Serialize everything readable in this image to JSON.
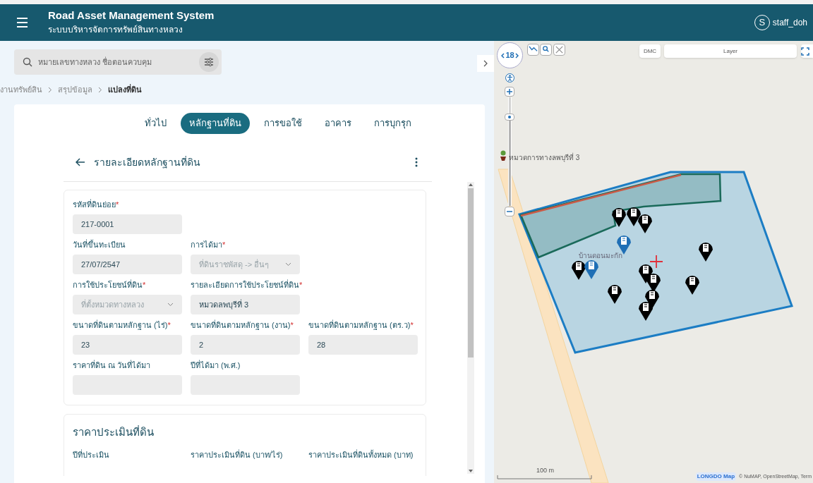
{
  "header": {
    "title": "Road Asset Management System",
    "subtitle": "ระบบบริหารจัดการทรัพย์สินทางหลวง",
    "user": {
      "initial": "S",
      "name": "staff_doh"
    }
  },
  "search": {
    "placeholder": "หมายเลขทางหลวง ชื่อตอนควบคุม"
  },
  "breadcrumbs": [
    {
      "label": "งานทรัพย์สิน",
      "current": false
    },
    {
      "label": "สรุปข้อมูล",
      "current": false
    },
    {
      "label": "แปลงที่ดิน",
      "current": true
    }
  ],
  "tabs": [
    {
      "label": "ทั่วไป",
      "selected": false
    },
    {
      "label": "หลักฐานที่ดิน",
      "selected": true
    },
    {
      "label": "การขอใช้",
      "selected": false
    },
    {
      "label": "อาคาร",
      "selected": false
    },
    {
      "label": "การบุกรุก",
      "selected": false
    }
  ],
  "detail": {
    "title": "รายละเอียดหลักฐานที่ดิน",
    "rows": [
      [
        {
          "label": "รหัสที่ดินย่อย",
          "mark": "*",
          "value": "217-0001",
          "kind": "input"
        }
      ],
      [
        {
          "label": "วันที่ขึ้นทะเบียน",
          "value": "27/07/2547",
          "kind": "input"
        },
        {
          "label": "การได้มา",
          "mark": "*",
          "value": "ที่ดินราชพัสดุ -> อื่นๆ",
          "kind": "select"
        }
      ],
      [
        {
          "label": "การใช้ประโยชน์ที่ดิน",
          "mark": "*",
          "value": "ที่ตั้งหมวดทางหลวง",
          "kind": "select"
        },
        {
          "label": "รายละเอียดการใช้ประโยชน์ที่ดิน",
          "mark": "*",
          "value": "หมวดลพบุรีที่ 3",
          "kind": "input"
        }
      ],
      [
        {
          "label": "ขนาดที่ดินตามหลักฐาน (ไร่)",
          "mark": "*",
          "value": "23",
          "kind": "input"
        },
        {
          "label": "ขนาดที่ดินตามหลักฐาน (งาน)",
          "mark": "*",
          "value": "2",
          "kind": "input"
        },
        {
          "label": "ขนาดที่ดินตามหลักฐาน (ตร.ว)",
          "mark": "*",
          "value": "28",
          "kind": "input"
        }
      ],
      [
        {
          "label": "ราคาที่ดิน ณ วันที่ได้มา",
          "kind": "input"
        },
        {
          "label": "ปีที่ได้มา (พ.ศ.)",
          "kind": "input"
        }
      ]
    ]
  },
  "appraisal": {
    "title": "ราคาประเมินที่ดิน",
    "labels": [
      "ปีที่ประเมิน",
      "ราคาประเมินที่ดิน (บาท/ไร่)",
      "ราคาประเมินที่ดินทั้งหมด (บาท)"
    ]
  },
  "map": {
    "zoom": "18",
    "zoom_slider": {
      "level": 0.84
    },
    "dmc": "DMC",
    "layer": "Layer",
    "places": [
      "หมวดการทางลพบุรีที่ 3",
      "บ้านดอนมะกัก"
    ],
    "scale": "100 m",
    "logo": "LONGDO Map",
    "attribution": "© NuMAP, OpenStreetMap, Term",
    "markers": [
      {
        "color": "#000000"
      },
      {
        "color": "#000000"
      },
      {
        "color": "#000000"
      },
      {
        "color": "#000000"
      },
      {
        "color": "#000000"
      },
      {
        "color": "#000000"
      },
      {
        "color": "#000000"
      },
      {
        "color": "#000000"
      },
      {
        "color": "#000000"
      },
      {
        "color": "#000000"
      },
      {
        "color": "#000000"
      },
      {
        "color": "#1f6fb5"
      },
      {
        "color": "#1f6fb5"
      }
    ]
  }
}
